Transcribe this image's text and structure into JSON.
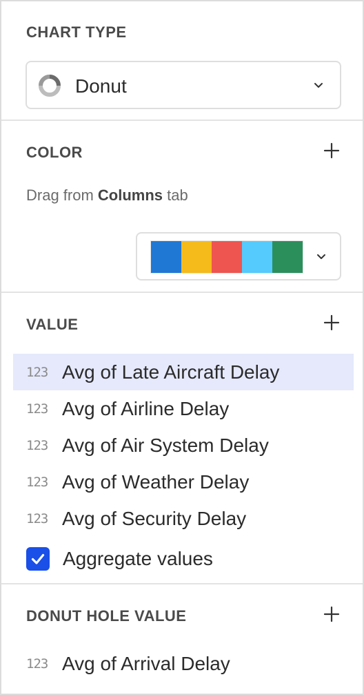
{
  "chart_type": {
    "title": "CHART TYPE",
    "selected": "Donut",
    "icon": "donut-chart-icon"
  },
  "color": {
    "title": "COLOR",
    "hint_prefix": "Drag from ",
    "hint_bold": "Columns",
    "hint_suffix": " tab",
    "palette": [
      "#1f78d4",
      "#f5bb1a",
      "#ef5550",
      "#54cbfc",
      "#2b8f5c"
    ]
  },
  "value": {
    "title": "VALUE",
    "type_icon_text": "123",
    "items": [
      {
        "label": "Avg of Late Aircraft Delay",
        "selected": true
      },
      {
        "label": "Avg of Airline Delay",
        "selected": false
      },
      {
        "label": "Avg of Air System Delay",
        "selected": false
      },
      {
        "label": "Avg of Weather Delay",
        "selected": false
      },
      {
        "label": "Avg of Security Delay",
        "selected": false
      }
    ],
    "aggregate": {
      "label": "Aggregate values",
      "checked": true
    }
  },
  "donut_hole": {
    "title": "DONUT HOLE VALUE",
    "type_icon_text": "123",
    "item": "Avg of Arrival Delay"
  },
  "colors": {
    "accent": "#1a4fe8",
    "selected_row": "#e5e9fb",
    "border": "#dedede"
  }
}
